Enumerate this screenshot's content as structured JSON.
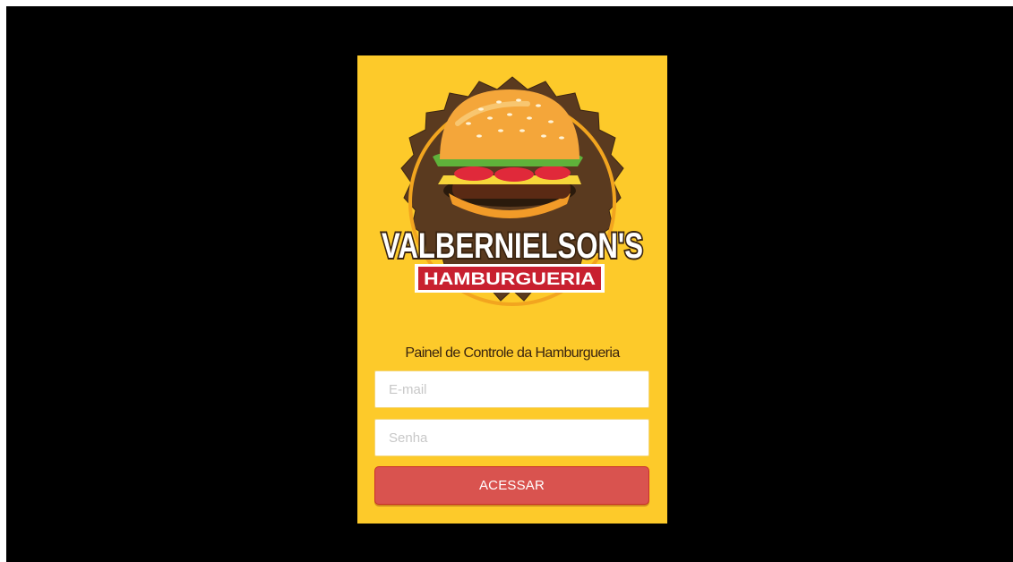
{
  "logo": {
    "name": "VALBERNIELSON'S",
    "tagline": "HAMBURGUERIA"
  },
  "panel": {
    "subtitle": "Painel de Controle da Hamburgueria"
  },
  "form": {
    "email_placeholder": "E-mail",
    "email_value": "",
    "password_placeholder": "Senha",
    "password_value": "",
    "submit_label": "ACESSAR"
  },
  "colors": {
    "page_background": "#000000",
    "panel_background": "#fdca2a",
    "button": "#d9534f",
    "badge_brown": "#5a3a1f",
    "banner_red": "#c8202f"
  }
}
